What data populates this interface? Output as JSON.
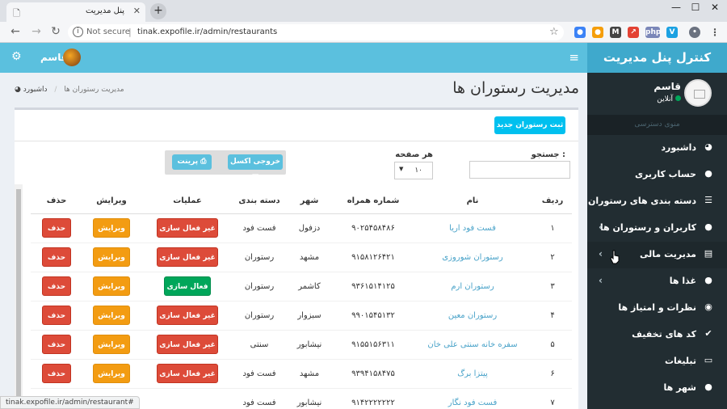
{
  "browser": {
    "tab_title": "پنل مدیریت",
    "tab_close": "✕",
    "new_tab": "+",
    "window_controls": [
      "—",
      "☐",
      "✕"
    ],
    "not_secure": "Not secure",
    "url": "tinak.expofile.ir/admin/restaurants",
    "status_url": "tinak.expofile.ir/admin/restaurant#",
    "extensions": [
      {
        "label": "●",
        "color": "#3b82f6"
      },
      {
        "label": "●",
        "color": "#f59e0b"
      },
      {
        "label": "M",
        "color": "#444444"
      },
      {
        "label": "↗",
        "color": "#e34234"
      },
      {
        "label": "php",
        "color": "#7a86b8"
      },
      {
        "label": "V",
        "color": "#1ba1e2"
      },
      {
        "label": "•",
        "color": "#6b7280"
      },
      {
        "label": "g",
        "color": "#444444"
      }
    ]
  },
  "header": {
    "brand": "کنترل پنل مدیریت",
    "user_name": "قاسم"
  },
  "sidebar": {
    "user_name": "قاسم",
    "status": "آنلاین",
    "menu_header": "منوی دسترسی",
    "items": [
      {
        "label": "داشبورد",
        "icon": "dashboard-icon",
        "glyph": "◕",
        "chevron": false
      },
      {
        "label": "حساب کاربری",
        "icon": "user-icon",
        "glyph": "●",
        "chevron": false
      },
      {
        "label": "دسته بندی های رستوران",
        "icon": "list-icon",
        "glyph": "☰",
        "chevron": false
      },
      {
        "label": "کاربران و رستوران ها",
        "icon": "user-icon",
        "glyph": "●",
        "chevron": true
      },
      {
        "label": "مدیریت مالی",
        "icon": "bank-icon",
        "glyph": "▤",
        "chevron": true
      },
      {
        "label": "غذا ها",
        "icon": "apple-icon",
        "glyph": "●",
        "chevron": true
      },
      {
        "label": "نظرات و امتیاز ها",
        "icon": "comment-icon",
        "glyph": "◉",
        "chevron": false
      },
      {
        "label": "کد های تخفیف",
        "icon": "check-icon",
        "glyph": "✔",
        "chevron": false
      },
      {
        "label": "تبلیغات",
        "icon": "monitor-icon",
        "glyph": "▭",
        "chevron": false
      },
      {
        "label": "شهر ها",
        "icon": "map-marker-icon",
        "glyph": "●",
        "chevron": false
      }
    ]
  },
  "page": {
    "title": "مدیریت رستوران ها",
    "breadcrumb_home": "داشبورد",
    "breadcrumb_current": "مدیریت رستوران ها",
    "new_button": "ثبت رستوران جدید",
    "search_label": "جستجو :",
    "per_page_label": "هر صفحه",
    "per_page_value": "۱۰",
    "excel_button": "خروجی اکسل",
    "print_button": "پرینت"
  },
  "table": {
    "headers": {
      "row": "ردیف",
      "name": "نام",
      "phone": "شماره همراه",
      "city": "شهر",
      "category": "دسته بندی",
      "actions": "عملیات",
      "edit": "ویرایش",
      "delete": "حذف"
    },
    "rows": [
      {
        "num": "۱",
        "name": "فست فود اریا",
        "phone": "۹۰۲۵۴۵۸۴۸۶",
        "city": "دزفول",
        "category": "فست فود",
        "action": "غیر فعال سازی",
        "active": false,
        "edit": "ویرایش",
        "delete": "حذف"
      },
      {
        "num": "۲",
        "name": "رستوران شوروزی",
        "phone": "۹۱۵۸۱۲۶۴۲۱",
        "city": "مشهد",
        "category": "رستوران",
        "action": "غیر فعال سازی",
        "active": false,
        "edit": "ویرایش",
        "delete": "حذف"
      },
      {
        "num": "۳",
        "name": "رستوران ارم",
        "phone": "۹۳۶۱۵۱۴۱۲۵",
        "city": "کاشمر",
        "category": "رستوران",
        "action": "فعال سازی",
        "active": true,
        "edit": "ویرایش",
        "delete": "حذف"
      },
      {
        "num": "۴",
        "name": "رستوران معین",
        "phone": "۹۹۰۱۵۴۵۱۳۲",
        "city": "سبزوار",
        "category": "رستوران",
        "action": "غیر فعال سازی",
        "active": false,
        "edit": "ویرایش",
        "delete": "حذف"
      },
      {
        "num": "۵",
        "name": "سفره خانه سنتی علی خان",
        "phone": "۹۱۵۵۱۵۶۳۱۱",
        "city": "نیشابور",
        "category": "سنتی",
        "action": "غیر فعال سازی",
        "active": false,
        "edit": "ویرایش",
        "delete": "حذف"
      },
      {
        "num": "۶",
        "name": "پیتزا برگ",
        "phone": "۹۳۹۴۱۵۸۴۷۵",
        "city": "مشهد",
        "category": "فست فود",
        "action": "غیر فعال سازی",
        "active": false,
        "edit": "ویرایش",
        "delete": "حذف"
      },
      {
        "num": "۷",
        "name": "فست فود نگار",
        "phone": "۹۱۴۲۲۲۲۲۲۲",
        "city": "نیشابور",
        "category": "فست فود",
        "action": "",
        "active": false,
        "edit": "",
        "delete": ""
      }
    ]
  }
}
